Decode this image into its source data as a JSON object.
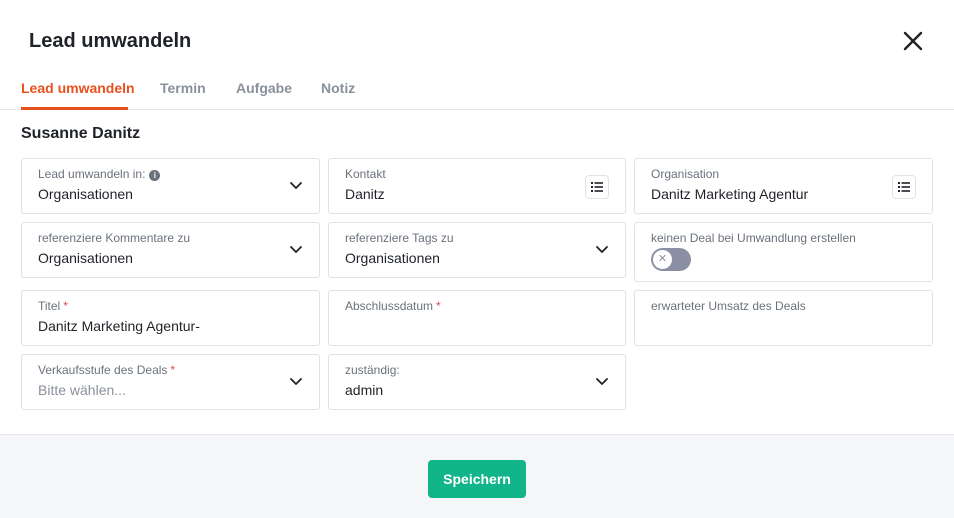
{
  "modal": {
    "title": "Lead umwandeln"
  },
  "tabs": [
    {
      "label": "Lead umwandeln",
      "active": true
    },
    {
      "label": "Termin",
      "active": false
    },
    {
      "label": "Aufgabe",
      "active": false
    },
    {
      "label": "Notiz",
      "active": false
    }
  ],
  "person_name": "Susanne Danitz",
  "fields": {
    "convert_to": {
      "label": "Lead umwandeln in:",
      "value": "Organisationen"
    },
    "contact": {
      "label": "Kontakt",
      "value": "Danitz"
    },
    "organization": {
      "label": "Organisation",
      "value": "Danitz Marketing Agentur"
    },
    "ref_comments": {
      "label": "referenziere Kommentare zu",
      "value": "Organisationen"
    },
    "ref_tags": {
      "label": "referenziere Tags zu",
      "value": "Organisationen"
    },
    "no_deal": {
      "label": "keinen Deal bei Umwandlung erstellen",
      "toggle_on": false
    },
    "title": {
      "label": "Titel",
      "required_mark": "*",
      "value": "Danitz Marketing Agentur-"
    },
    "close_date": {
      "label": "Abschlussdatum",
      "required_mark": "*",
      "value": ""
    },
    "expected_revenue": {
      "label": "erwarteter Umsatz des Deals",
      "value": ""
    },
    "sales_stage": {
      "label": "Verkaufsstufe des Deals",
      "required_mark": "*",
      "placeholder": "Bitte wählen..."
    },
    "assignee": {
      "label": "zuständig:",
      "value": "admin"
    }
  },
  "footer": {
    "save_label": "Speichern"
  },
  "colors": {
    "accent": "#e8501e",
    "primary_button": "#12b48a",
    "required": "#e5484d",
    "toggle_off": "#8b8fa3"
  },
  "icons": {
    "close": "close-icon",
    "chevron": "chevron-down-icon",
    "list": "list-icon",
    "info": "info-icon",
    "toggle_x": "x-icon"
  }
}
